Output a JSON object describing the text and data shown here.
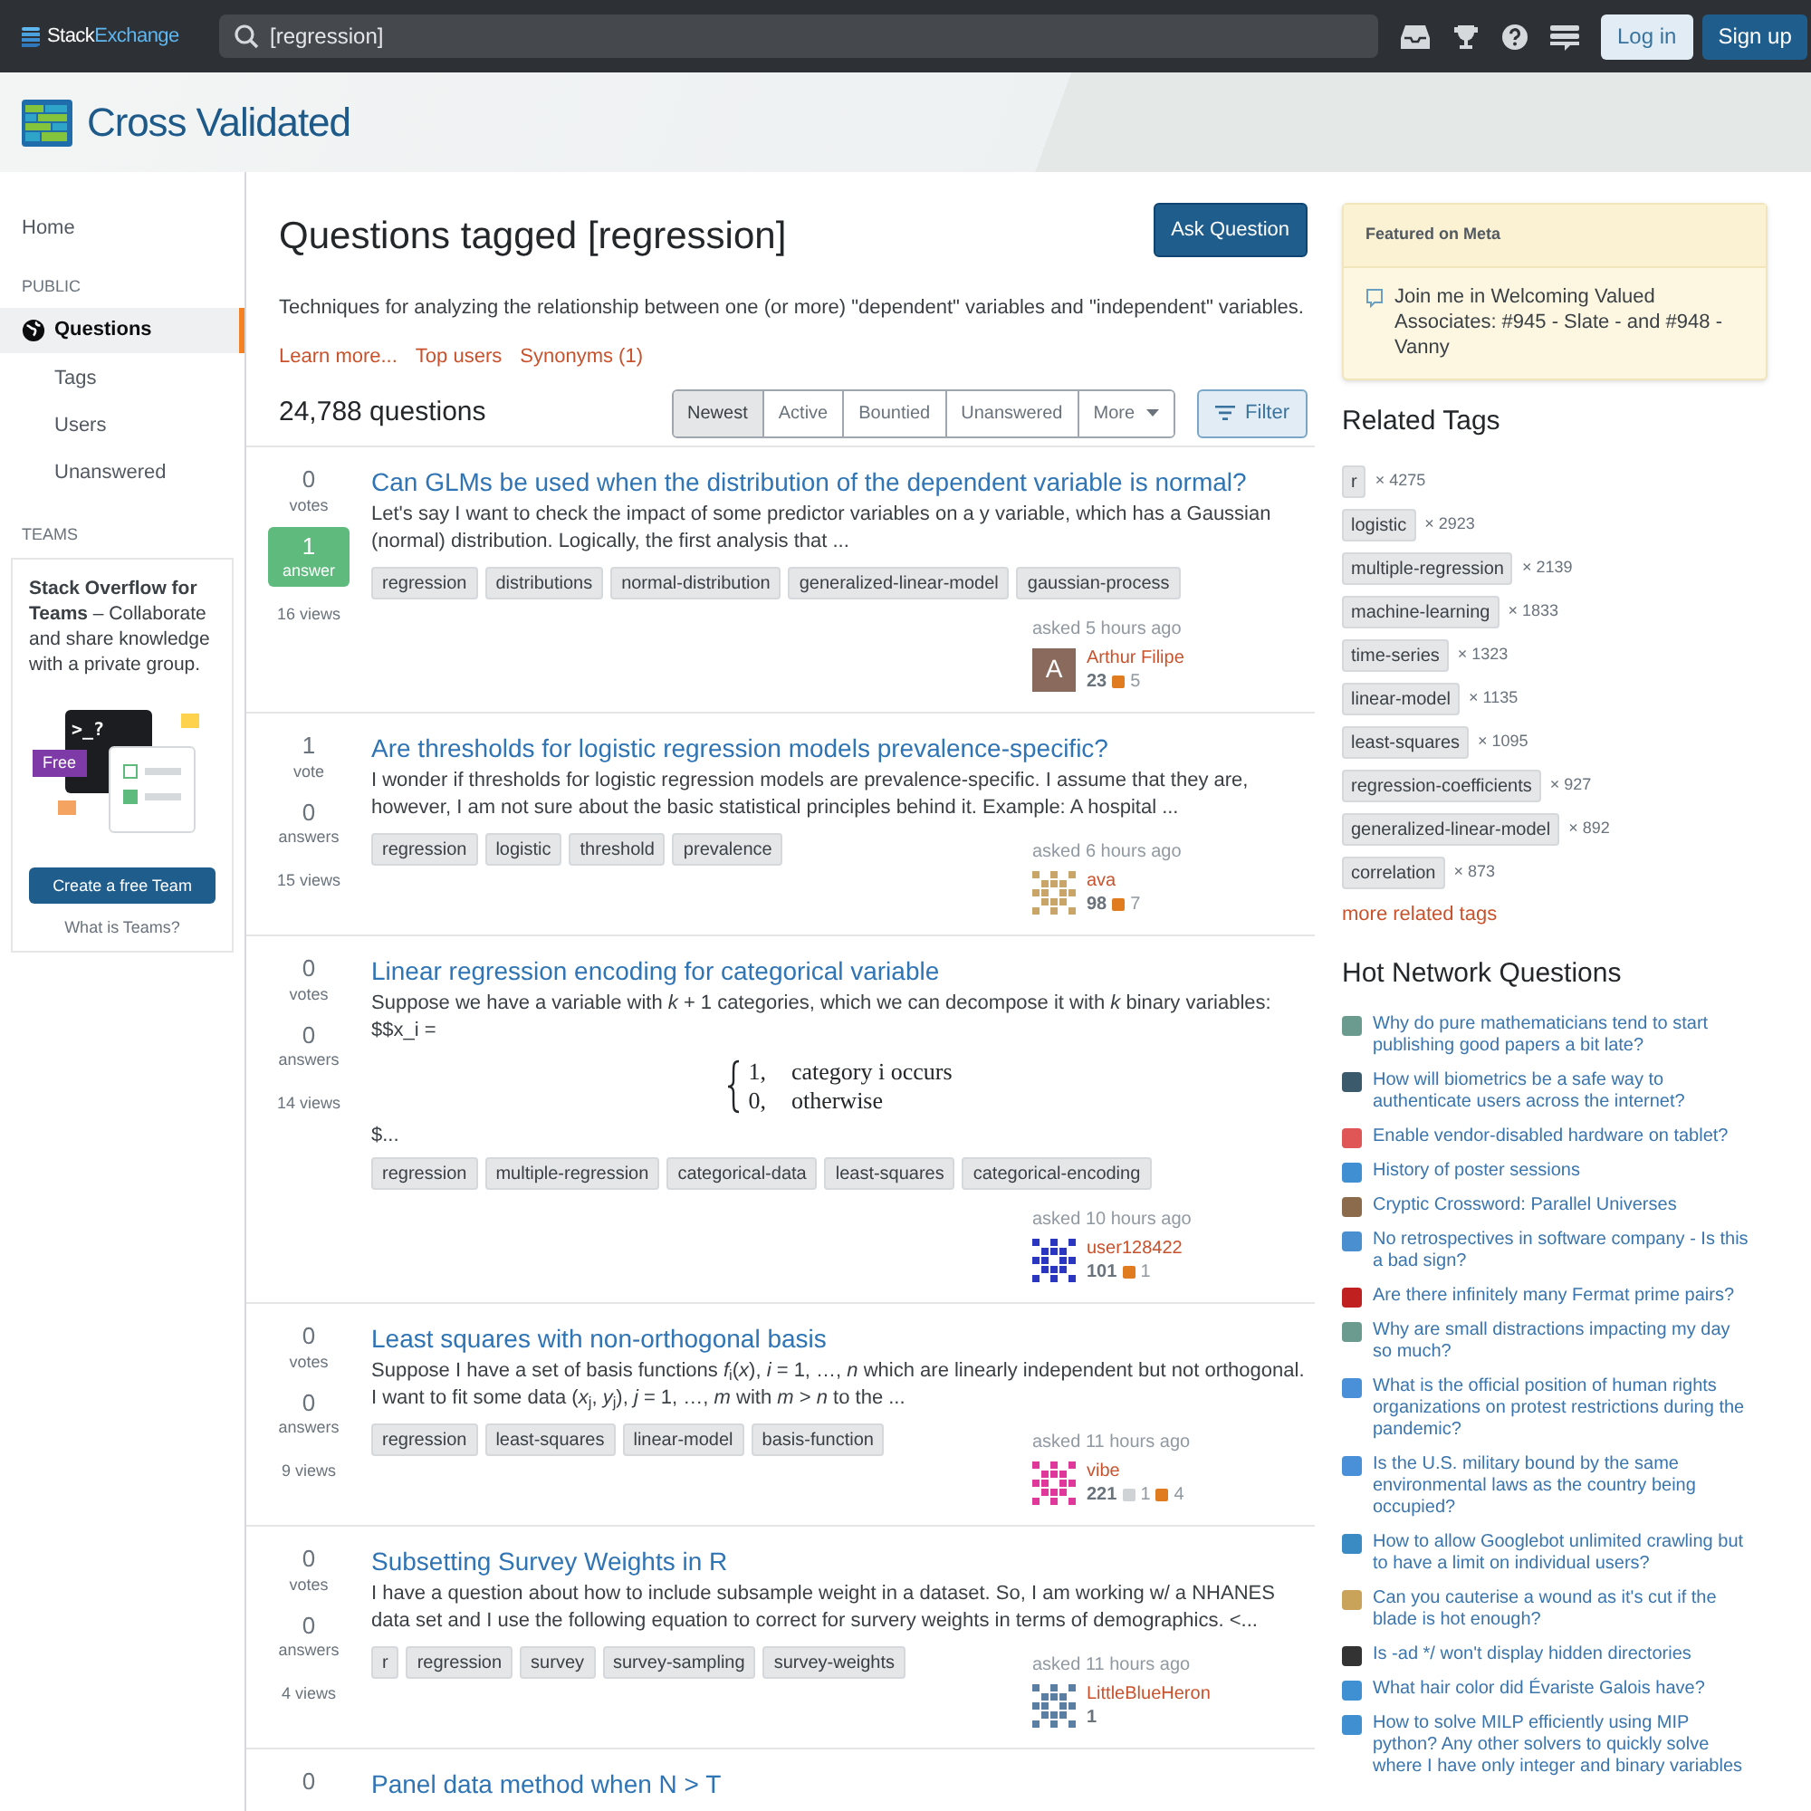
{
  "topbar": {
    "brand_first": "Stack",
    "brand_second": "Exchange",
    "search": {
      "value": "[regression]"
    },
    "buttons": [
      {
        "label": "Log in",
        "kind": "secondary"
      },
      {
        "label": "Sign up",
        "kind": "primary"
      }
    ]
  },
  "site": {
    "name": "Cross Validated"
  },
  "sidebar": {
    "home": "Home",
    "sections": [
      {
        "heading": "PUBLIC",
        "items": [
          {
            "label": "Questions",
            "selected": true,
            "kind": "main"
          },
          {
            "label": "Tags",
            "selected": false,
            "kind": "sub"
          },
          {
            "label": "Users",
            "selected": false,
            "kind": "sub"
          },
          {
            "label": "Unanswered",
            "selected": false,
            "kind": "sub"
          }
        ]
      },
      {
        "heading": "TEAMS"
      }
    ],
    "teams": {
      "text": "**Stack Overflow for Teams** – Collaborate and share knowledge with a private group.",
      "prompt": ">_?",
      "free": "Free",
      "button": "Create a free Team",
      "link": "What is Teams?"
    }
  },
  "header": {
    "title": "Questions tagged [regression]",
    "ask_button": "Ask Question",
    "description": "Techniques for analyzing the relationship between one (or more) \"dependent\" variables and \"independent\" variables.",
    "links": [
      "Learn more...",
      "Top users",
      "Synonyms (1)"
    ]
  },
  "list_header": {
    "count": "24,788 questions",
    "tabs": [
      {
        "label": "Newest",
        "selected": true,
        "dropdown": false
      },
      {
        "label": "Active",
        "selected": false,
        "dropdown": false
      },
      {
        "label": "Bountied",
        "selected": false,
        "dropdown": false
      },
      {
        "label": "Unanswered",
        "selected": false,
        "dropdown": false
      },
      {
        "label": "More",
        "selected": false,
        "dropdown": true
      }
    ],
    "filter_button": "Filter"
  },
  "questions": [
    {
      "votes": "0",
      "votes_label": "votes",
      "answers": "1",
      "answers_label": "answer",
      "accepted": true,
      "views": "16 views",
      "title": "Can GLMs be used when the distribution of the dependent variable is normal?",
      "excerpt": "Let's say I want to check the impact of some predictor variables on a y variable, which has a Gaussian (normal) distribution. Logically, the first analysis that ...",
      "tags": [
        "regression",
        "distributions",
        "normal-distribution",
        "generalized-linear-model",
        "gaussian-process"
      ],
      "asked": "asked 5 hours ago",
      "user": {
        "name": "Arthur Filipe",
        "avatar": {
          "kind": "letter",
          "letter": "A",
          "color": "#8a6a5c"
        },
        "reputation": "23",
        "badges": [
          {
            "kind": "bronze",
            "count": "5"
          }
        ]
      }
    },
    {
      "votes": "1",
      "votes_label": "vote",
      "answers": "0",
      "answers_label": "answers",
      "accepted": false,
      "views": "15 views",
      "title": "Are thresholds for logistic regression models prevalence-specific?",
      "excerpt": "I wonder if thresholds for logistic regression models are prevalence-specific. I assume that they are, however, I am not sure about the basic statistical principles behind it. Example: A hospital ...",
      "tags": [
        "regression",
        "logistic",
        "threshold",
        "prevalence"
      ],
      "asked": "asked 6 hours ago",
      "user": {
        "name": "ava",
        "avatar": {
          "kind": "identicon",
          "color": "#c9a56a"
        },
        "reputation": "98",
        "badges": [
          {
            "kind": "bronze",
            "count": "7"
          }
        ]
      }
    },
    {
      "votes": "0",
      "votes_label": "votes",
      "answers": "0",
      "answers_label": "answers",
      "accepted": false,
      "views": "14 views",
      "title": "Linear regression encoding for categorical variable",
      "excerpt": "Suppose we have a variable with *k* + 1 categories, which we can decompose it with *k* binary variables: $$x_i =",
      "cases": [
        {
          "value": "1,",
          "condition": "category i occurs"
        },
        {
          "value": "0,",
          "condition": "otherwise"
        }
      ],
      "excerpt_end": "$...",
      "tags": [
        "regression",
        "multiple-regression",
        "categorical-data",
        "least-squares",
        "categorical-encoding"
      ],
      "asked": "asked 10 hours ago",
      "user": {
        "name": "user128422",
        "avatar": {
          "kind": "identicon",
          "color": "#2a35c0"
        },
        "reputation": "101",
        "badges": [
          {
            "kind": "bronze",
            "count": "1"
          }
        ]
      }
    },
    {
      "votes": "0",
      "votes_label": "votes",
      "answers": "0",
      "answers_label": "answers",
      "accepted": false,
      "views": "9 views",
      "title": "Least squares with non-orthogonal basis",
      "excerpt": "Suppose I have a set of basis functions *f*$_{i}$(*x*), *i* = 1, …, *n* which are linearly independent but not orthogonal. I want to fit some data (*x*$_{j}$, *y*$_{j}$), *j* = 1, …, *m* with *m* > *n* to the ...",
      "tags": [
        "regression",
        "least-squares",
        "linear-model",
        "basis-function"
      ],
      "asked": "asked 11 hours ago",
      "user": {
        "name": "vibe",
        "avatar": {
          "kind": "identicon",
          "color": "#e0379a"
        },
        "reputation": "221",
        "badges": [
          {
            "kind": "silver",
            "count": "1"
          },
          {
            "kind": "bronze",
            "count": "4"
          }
        ]
      }
    },
    {
      "votes": "0",
      "votes_label": "votes",
      "answers": "0",
      "answers_label": "answers",
      "accepted": false,
      "views": "4 views",
      "title": "Subsetting Survey Weights in R",
      "excerpt": "I have a question about how to include subsample weight in a dataset. So, I am working w/ a NHANES data set and I use the following equation to correct for survery weights in terms of demographics. <...",
      "tags": [
        "r",
        "regression",
        "survey",
        "survey-sampling",
        "survey-weights"
      ],
      "asked": "asked 11 hours ago",
      "user": {
        "name": "LittleBlueHeron",
        "avatar": {
          "kind": "identicon",
          "color": "#5a7fa3"
        },
        "reputation": "1"
      }
    },
    {
      "votes": "0",
      "title": "Panel data method when N > T"
    }
  ],
  "featured": {
    "heading": "Featured on Meta",
    "items": [
      "Join me in Welcoming Valued Associates: #945 - Slate - and #948 - Vanny"
    ]
  },
  "related_tags": {
    "heading": "Related Tags",
    "tags": [
      {
        "name": "r",
        "count": "× 4275"
      },
      {
        "name": "logistic",
        "count": "× 2923"
      },
      {
        "name": "multiple-regression",
        "count": "× 2139"
      },
      {
        "name": "machine-learning",
        "count": "× 1833"
      },
      {
        "name": "time-series",
        "count": "× 1323"
      },
      {
        "name": "linear-model",
        "count": "× 1135"
      },
      {
        "name": "least-squares",
        "count": "× 1095"
      },
      {
        "name": "regression-coefficients",
        "count": "× 927"
      },
      {
        "name": "generalized-linear-model",
        "count": "× 892"
      },
      {
        "name": "correlation",
        "count": "× 873"
      }
    ],
    "more": "more related tags"
  },
  "hot_network": {
    "heading": "Hot Network Questions",
    "items": [
      {
        "title": "Why do pure mathematicians tend to start publishing good papers a bit late?",
        "color": "#6a9b8e"
      },
      {
        "title": "How will biometrics be a safe way to authenticate users across the internet?",
        "color": "#3b5a6b"
      },
      {
        "title": "Enable vendor-disabled hardware on tablet?",
        "color": "#e05555"
      },
      {
        "title": "History of poster sessions",
        "color": "#3f8fd2"
      },
      {
        "title": "Cryptic Crossword: Parallel Universes",
        "color": "#8b6b4b"
      },
      {
        "title": "No retrospectives in software company - Is this a bad sign?",
        "color": "#4a8fd0"
      },
      {
        "title": "Are there infinitely many Fermat prime pairs?",
        "color": "#c0201f"
      },
      {
        "title": "Why are small distractions impacting my day so much?",
        "color": "#6a9b8e"
      },
      {
        "title": "What is the official position of human rights organizations on protest restrictions during the pandemic?",
        "color": "#4a90d9"
      },
      {
        "title": "Is the U.S. military bound by the same environmental laws as the country being occupied?",
        "color": "#4a90d8"
      },
      {
        "title": "How to allow Googlebot unlimited crawling but to have a limit on individual users?",
        "color": "#3a8ac4"
      },
      {
        "title": "Can you cauterise a wound as it's cut if the blade is hot enough?",
        "color": "#c9a35a"
      },
      {
        "title": "Is -ad */ won't display hidden directories",
        "color": "#333333"
      },
      {
        "title": "What hair color did Évariste Galois have?",
        "color": "#3f8fd3"
      },
      {
        "title": "How to solve MILP efficiently using MIP python? Any other solvers to quickly solve where I have only integer and binary variables",
        "color": "#3f8fd1"
      }
    ]
  }
}
